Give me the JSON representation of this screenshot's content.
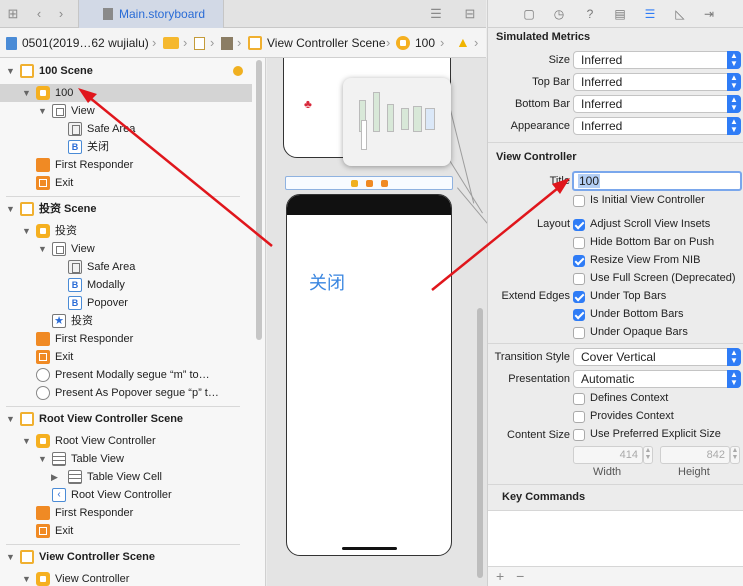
{
  "editor": {
    "tab_title": "Main.storyboard",
    "breadcrumb": {
      "project": "0501(2019…62 wujialu)",
      "scene": "View Controller Scene",
      "controller": "100"
    }
  },
  "outline": {
    "rows": [
      {
        "label": "100 Scene",
        "icon": "scene-icon",
        "level": 0,
        "bold": true
      },
      {
        "label": "100",
        "icon": "view-controller-icon",
        "level": 1,
        "selected": true
      },
      {
        "label": "View",
        "icon": "view-icon",
        "level": 2
      },
      {
        "label": "Safe Area",
        "icon": "safe-area-icon",
        "level": 3
      },
      {
        "label": "关闭",
        "icon": "button-icon",
        "level": 3
      },
      {
        "label": "First Responder",
        "icon": "first-responder-icon",
        "level": 1
      },
      {
        "label": "Exit",
        "icon": "exit-icon",
        "level": 1
      },
      {
        "label": "投资 Scene",
        "icon": "scene-icon",
        "level": 0,
        "bold": true
      },
      {
        "label": "投资",
        "icon": "view-controller-icon",
        "level": 1
      },
      {
        "label": "View",
        "icon": "view-icon",
        "level": 2
      },
      {
        "label": "Safe Area",
        "icon": "safe-area-icon",
        "level": 3
      },
      {
        "label": "Modally",
        "icon": "button-icon",
        "level": 3
      },
      {
        "label": "Popover",
        "icon": "button-icon",
        "level": 3
      },
      {
        "label": "投资",
        "icon": "tab-bar-item-icon",
        "level": 2
      },
      {
        "label": "First Responder",
        "icon": "first-responder-icon",
        "level": 1
      },
      {
        "label": "Exit",
        "icon": "exit-icon",
        "level": 1
      },
      {
        "label": "Present Modally segue “m” to…",
        "icon": "segue-icon",
        "level": 1
      },
      {
        "label": "Present As Popover segue “p” t…",
        "icon": "segue-icon",
        "level": 1
      },
      {
        "label": "Root View Controller Scene",
        "icon": "scene-icon",
        "level": 0,
        "bold": true
      },
      {
        "label": "Root View Controller",
        "icon": "table-view-controller-icon",
        "level": 1
      },
      {
        "label": "Table View",
        "icon": "table-view-icon",
        "level": 2
      },
      {
        "label": "Table View Cell",
        "icon": "table-view-icon",
        "level": 3
      },
      {
        "label": "Root View Controller",
        "icon": "navigation-item-icon",
        "level": 2
      },
      {
        "label": "First Responder",
        "icon": "first-responder-icon",
        "level": 1
      },
      {
        "label": "Exit",
        "icon": "exit-icon",
        "level": 1
      },
      {
        "label": "View Controller Scene",
        "icon": "scene-icon",
        "level": 0,
        "bold": true
      },
      {
        "label": "View Controller",
        "icon": "view-controller-icon",
        "level": 1
      }
    ]
  },
  "canvas": {
    "button_label": "关闭"
  },
  "inspector": {
    "simulated_metrics": {
      "title": "Simulated Metrics",
      "fields": [
        {
          "label": "Size",
          "value": "Inferred"
        },
        {
          "label": "Top Bar",
          "value": "Inferred"
        },
        {
          "label": "Bottom Bar",
          "value": "Inferred"
        },
        {
          "label": "Appearance",
          "value": "Inferred"
        }
      ]
    },
    "view_controller": {
      "title": "View Controller",
      "title_label": "Title",
      "title_value": "100",
      "initial_label": "Is Initial View Controller",
      "layout_label": "Layout",
      "layout_options": [
        {
          "label": "Adjust Scroll View Insets",
          "checked": true
        },
        {
          "label": "Hide Bottom Bar on Push",
          "checked": false
        },
        {
          "label": "Resize View From NIB",
          "checked": true
        },
        {
          "label": "Use Full Screen (Deprecated)",
          "checked": false
        }
      ],
      "extend_label": "Extend Edges",
      "extend_options": [
        {
          "label": "Under Top Bars",
          "checked": true
        },
        {
          "label": "Under Bottom Bars",
          "checked": true
        },
        {
          "label": "Under Opaque Bars",
          "checked": false
        }
      ],
      "transition_label": "Transition Style",
      "transition_value": "Cover Vertical",
      "presentation_label": "Presentation",
      "presentation_value": "Automatic",
      "defines_context": "Defines Context",
      "provides_context": "Provides Context",
      "content_size_label": "Content Size",
      "content_size_option": "Use Preferred Explicit Size",
      "width_value": "414",
      "height_value": "842",
      "width_label": "Width",
      "height_label": "Height"
    },
    "key_commands": {
      "title": "Key Commands"
    },
    "footer": {
      "add": "+",
      "remove": "−"
    }
  },
  "colors": {
    "accent": "#2f7cf6",
    "scene_icon": "#f0b030",
    "annotation_arrow": "#e0161c"
  }
}
